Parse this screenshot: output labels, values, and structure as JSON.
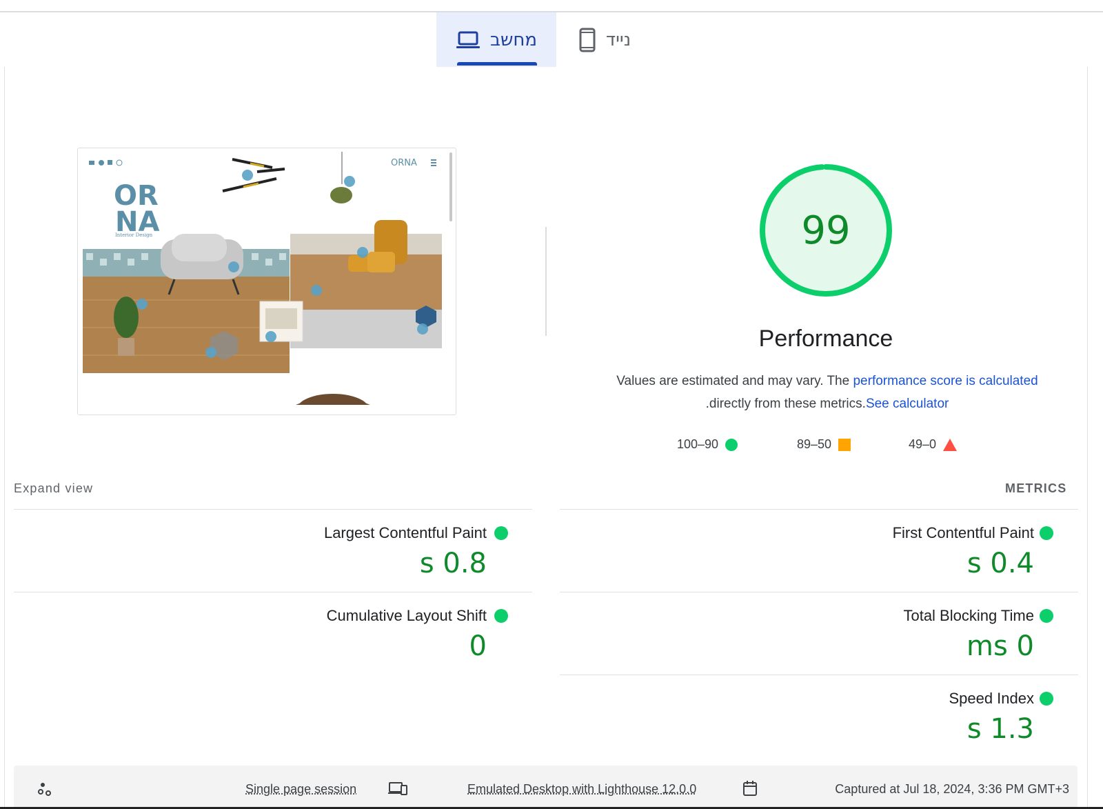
{
  "tabs": {
    "desktop_label": "מחשב",
    "mobile_label": "נייד",
    "desktop_icon": "laptop-icon",
    "mobile_icon": "phone-icon"
  },
  "screenshot": {
    "brand_small": "ORNA",
    "brand_large_line1": "OR",
    "brand_large_line2": "NA",
    "tagline": "Interior Design"
  },
  "gauge": {
    "score": "99",
    "score_fraction": 0.99,
    "color": "#0cce6b",
    "fill": "#e5f8ec",
    "text_color": "#0f8a2a"
  },
  "performance": {
    "title": "Performance",
    "desc_prefix": "Values are estimated and may vary. The ",
    "desc_link1": "performance score is calculated",
    "desc_line2_text": ".directly from these metrics.",
    "desc_link2": "See calculator"
  },
  "legend": {
    "good": "100–90",
    "average": "89–50",
    "poor": "49–0",
    "colors": {
      "good": "#0cce6b",
      "average": "#ffa400",
      "poor": "#ff4e42"
    }
  },
  "metrics_section": {
    "heading": "METRICS",
    "expand_label": "Expand view",
    "items": [
      {
        "name": "First Contentful Paint",
        "value": "s 0.4",
        "status": "good"
      },
      {
        "name": "Largest Contentful Paint",
        "value": "s 0.8",
        "status": "good"
      },
      {
        "name": "Total Blocking Time",
        "value": "ms 0",
        "status": "good"
      },
      {
        "name": "Cumulative Layout Shift",
        "value": "0",
        "status": "good"
      },
      {
        "name": "Speed Index",
        "value": "s 1.3",
        "status": "good"
      }
    ]
  },
  "footer": {
    "captured": "Captured at Jul 18, 2024, 3:36 PM GMT+3",
    "emulated": "Emulated Desktop with Lighthouse 12.0.0",
    "session": "Single page session",
    "icons": [
      "calendar-icon",
      "devices-icon",
      "settings-nodes-icon"
    ]
  }
}
